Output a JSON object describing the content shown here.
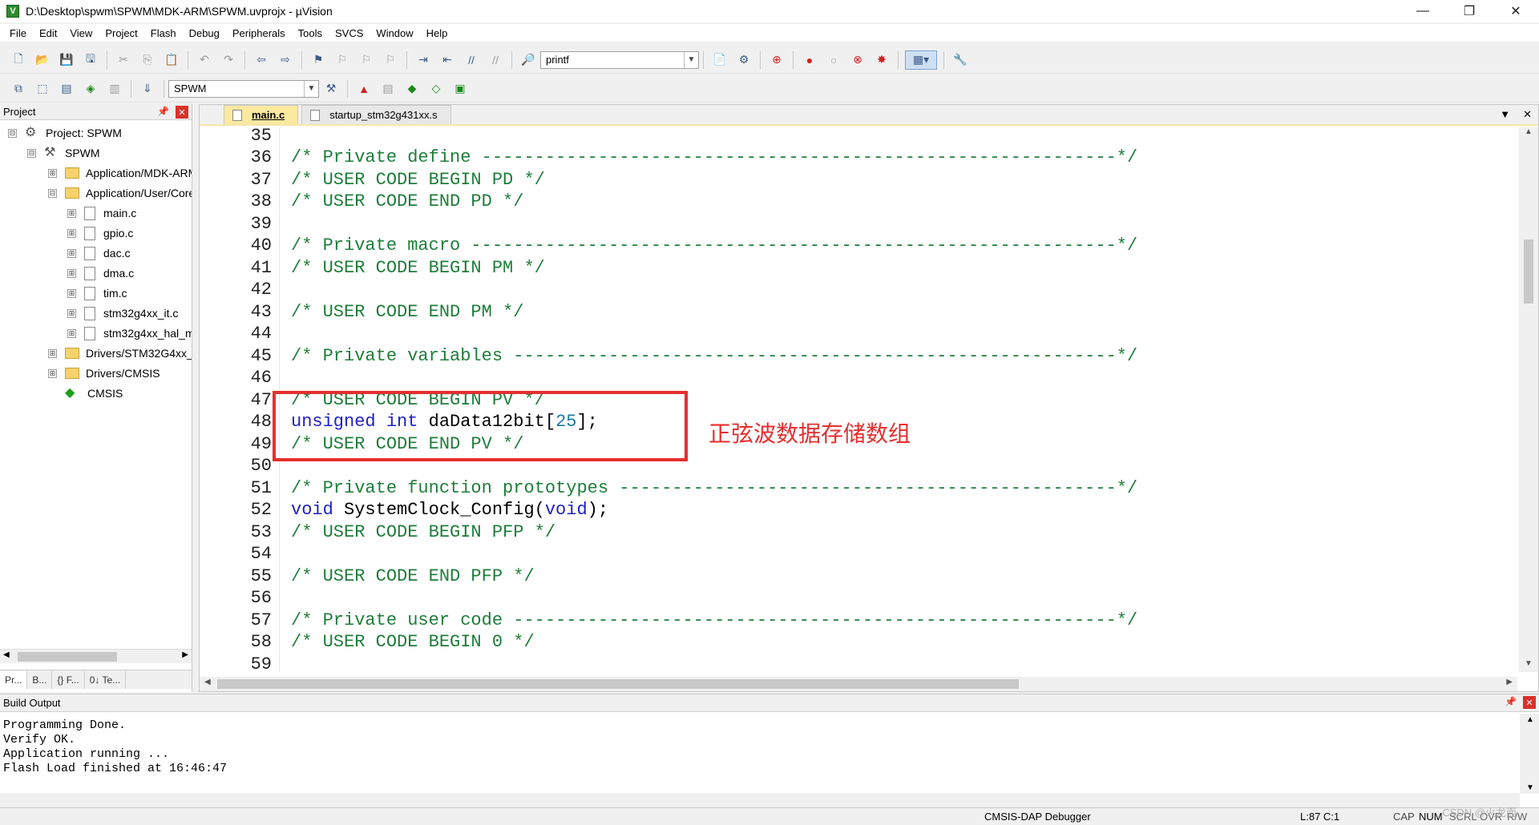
{
  "window": {
    "title": "D:\\Desktop\\spwm\\SPWM\\MDK-ARM\\SPWM.uvprojx - µVision",
    "controls": [
      "—",
      "❐",
      "✕"
    ]
  },
  "menu": [
    "File",
    "Edit",
    "View",
    "Project",
    "Flash",
    "Debug",
    "Peripherals",
    "Tools",
    "SVCS",
    "Window",
    "Help"
  ],
  "toolbar1": {
    "find_value": "printf"
  },
  "toolbar2": {
    "target_value": "SPWM"
  },
  "project_panel": {
    "title": "Project",
    "tree": [
      {
        "label": "Project: SPWM",
        "icon": "project-gear-icon",
        "expander": "⊟"
      },
      {
        "label": "SPWM",
        "icon": "target-icon",
        "expander": "⊟"
      },
      {
        "label": "Application/MDK-ARM",
        "icon": "folder-icon",
        "expander": "⊞"
      },
      {
        "label": "Application/User/Core",
        "icon": "folder-icon",
        "expander": "⊟"
      },
      {
        "label": "main.c",
        "icon": "file-icon",
        "expander": "⊞"
      },
      {
        "label": "gpio.c",
        "icon": "file-icon",
        "expander": "⊞"
      },
      {
        "label": "dac.c",
        "icon": "file-icon",
        "expander": "⊞"
      },
      {
        "label": "dma.c",
        "icon": "file-icon",
        "expander": "⊞"
      },
      {
        "label": "tim.c",
        "icon": "file-icon",
        "expander": "⊞"
      },
      {
        "label": "stm32g4xx_it.c",
        "icon": "file-icon",
        "expander": "⊞"
      },
      {
        "label": "stm32g4xx_hal_msp.c",
        "icon": "file-icon",
        "expander": "⊞"
      },
      {
        "label": "Drivers/STM32G4xx_HAL",
        "icon": "folder-icon",
        "expander": "⊞"
      },
      {
        "label": "Drivers/CMSIS",
        "icon": "folder-icon",
        "expander": "⊞"
      },
      {
        "label": "CMSIS",
        "icon": "cmsis-diamond-icon",
        "expander": ""
      }
    ],
    "tabs": [
      "Pr...",
      "B...",
      "{} F...",
      "0↓ Te..."
    ]
  },
  "editor": {
    "tabs": [
      {
        "label": "main.c",
        "active": true
      },
      {
        "label": "startup_stm32g431xx.s",
        "active": false
      }
    ],
    "lines": [
      {
        "n": "35",
        "segs": []
      },
      {
        "n": "36",
        "segs": [
          {
            "c": "cm",
            "t": "/* Private define ------------------------------------------------------------*/"
          }
        ]
      },
      {
        "n": "37",
        "segs": [
          {
            "c": "cm",
            "t": "/* USER CODE BEGIN PD */"
          }
        ]
      },
      {
        "n": "38",
        "segs": [
          {
            "c": "cm",
            "t": "/* USER CODE END PD */"
          }
        ]
      },
      {
        "n": "39",
        "segs": []
      },
      {
        "n": "40",
        "segs": [
          {
            "c": "cm",
            "t": "/* Private macro -------------------------------------------------------------*/"
          }
        ]
      },
      {
        "n": "41",
        "segs": [
          {
            "c": "cm",
            "t": "/* USER CODE BEGIN PM */"
          }
        ]
      },
      {
        "n": "42",
        "segs": []
      },
      {
        "n": "43",
        "segs": [
          {
            "c": "cm",
            "t": "/* USER CODE END PM */"
          }
        ]
      },
      {
        "n": "44",
        "segs": []
      },
      {
        "n": "45",
        "segs": [
          {
            "c": "cm",
            "t": "/* Private variables ---------------------------------------------------------*/"
          }
        ]
      },
      {
        "n": "46",
        "segs": []
      },
      {
        "n": "47",
        "segs": [
          {
            "c": "cm",
            "t": "/* USER CODE BEGIN PV */"
          }
        ]
      },
      {
        "n": "48",
        "segs": [
          {
            "c": "kw",
            "t": "unsigned"
          },
          {
            "c": "txt",
            "t": " "
          },
          {
            "c": "kw",
            "t": "int"
          },
          {
            "c": "txt",
            "t": " daData12bit["
          },
          {
            "c": "num",
            "t": "25"
          },
          {
            "c": "txt",
            "t": "];"
          }
        ]
      },
      {
        "n": "49",
        "segs": [
          {
            "c": "cm",
            "t": "/* USER CODE END PV */"
          }
        ]
      },
      {
        "n": "50",
        "segs": []
      },
      {
        "n": "51",
        "segs": [
          {
            "c": "cm",
            "t": "/* Private function prototypes -----------------------------------------------*/"
          }
        ]
      },
      {
        "n": "52",
        "segs": [
          {
            "c": "kw",
            "t": "void"
          },
          {
            "c": "txt",
            "t": " SystemClock_Config("
          },
          {
            "c": "kw",
            "t": "void"
          },
          {
            "c": "txt",
            "t": ");"
          }
        ]
      },
      {
        "n": "53",
        "segs": [
          {
            "c": "cm",
            "t": "/* USER CODE BEGIN PFP */"
          }
        ]
      },
      {
        "n": "54",
        "segs": []
      },
      {
        "n": "55",
        "segs": [
          {
            "c": "cm",
            "t": "/* USER CODE END PFP */"
          }
        ]
      },
      {
        "n": "56",
        "segs": []
      },
      {
        "n": "57",
        "segs": [
          {
            "c": "cm",
            "t": "/* Private user code ---------------------------------------------------------*/"
          }
        ]
      },
      {
        "n": "58",
        "segs": [
          {
            "c": "cm",
            "t": "/* USER CODE BEGIN 0 */"
          }
        ]
      },
      {
        "n": "59",
        "segs": []
      }
    ]
  },
  "annotation": {
    "text": "正弦波数据存储数组",
    "color": "#e62e2e"
  },
  "build_output": {
    "title": "Build Output",
    "lines": [
      "Programming Done.",
      "Verify OK.",
      "Application running ...",
      "Flash Load finished at 16:46:47"
    ]
  },
  "statusbar": {
    "debugger": "CMSIS-DAP Debugger",
    "position": "L:87 C:1",
    "caps": "CAP",
    "num": "NUM",
    "scrl": "SCRL",
    "ovr": "OVR",
    "rw": "R/W"
  },
  "watermark": "CSDN @火龙而"
}
